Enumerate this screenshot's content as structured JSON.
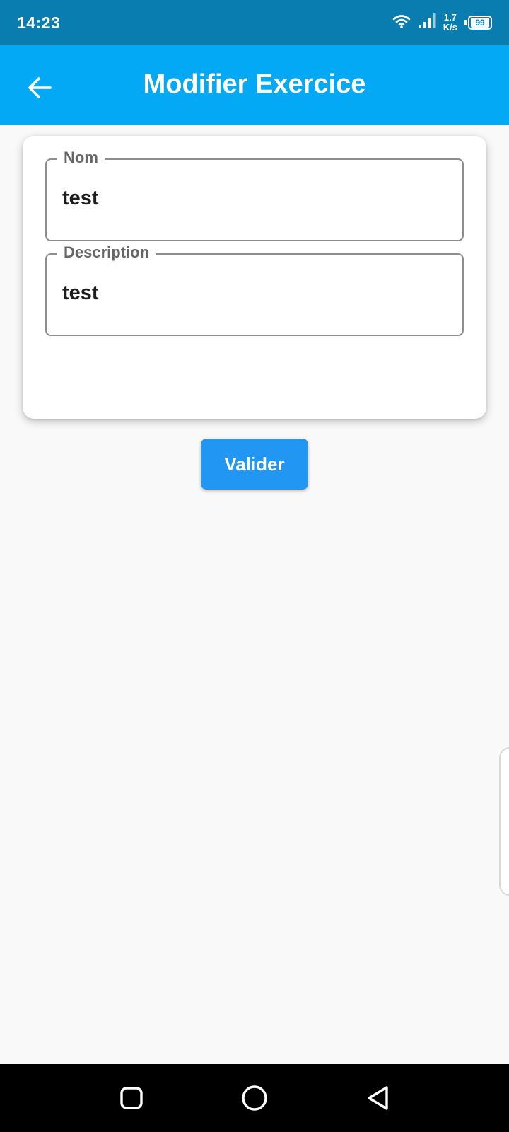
{
  "status_bar": {
    "time": "14:23",
    "net_speed_value": "1.7",
    "net_speed_unit": "K/s",
    "battery": "99",
    "icons": [
      "wifi-icon",
      "signal-icon",
      "battery-icon"
    ]
  },
  "app_bar": {
    "title": "Modifier Exercice",
    "back_icon": "arrow-left-icon"
  },
  "form": {
    "nom": {
      "label": "Nom",
      "value": "test"
    },
    "description": {
      "label": "Description",
      "value": "test"
    }
  },
  "actions": {
    "submit_label": "Valider"
  },
  "nav_bar": {
    "icons": [
      "recent-apps-icon",
      "home-icon",
      "back-icon"
    ]
  },
  "colors": {
    "status_bar": "#0a7db0",
    "app_bar": "#03a9f4",
    "button": "#2196f3",
    "background": "#f9f9fa"
  }
}
